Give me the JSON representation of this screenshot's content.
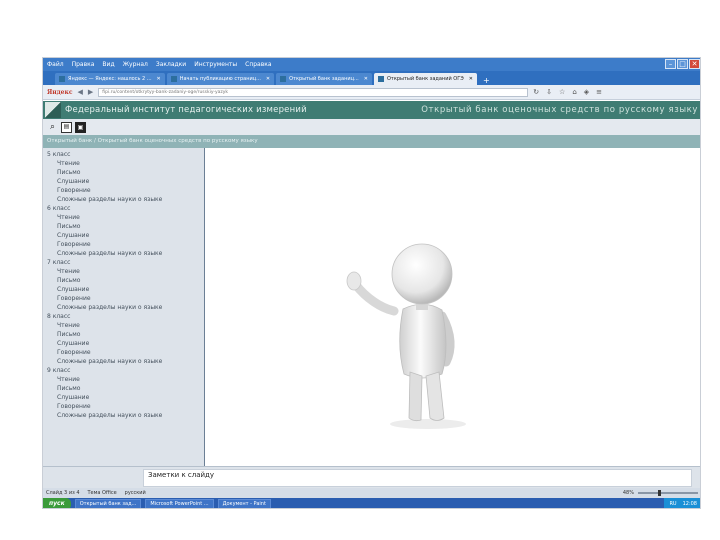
{
  "browser": {
    "menu": [
      "Файл",
      "Правка",
      "Вид",
      "Журнал",
      "Закладки",
      "Инструменты",
      "Справка"
    ],
    "tabs": [
      {
        "label": "Яндекс — Яндекс: нашлось 2 ..."
      },
      {
        "label": "Начать публикацию страниц..."
      },
      {
        "label": "Открытый банк заданиц..."
      },
      {
        "label": "Открытый банк заданий ОГЭ"
      }
    ],
    "active_tab": 3,
    "brand": "Яндекс",
    "url": "fipi.ru/content/otkrytyy-bank-zadaniy-oge/russkiy-yazyk",
    "search_placeholder": "Поиск",
    "colors": {
      "titlebar": "#3d7cc9",
      "header": "#3f7c73",
      "close": "#d34a3a"
    }
  },
  "site": {
    "institute": "Федеральный институт педагогических измерений",
    "bank_title": "Открытый банк оценочных средств по русскому языку",
    "breadcrumb": "Открытый банк / Открытый банк оценочных средств по русскому языку"
  },
  "sidebar": {
    "grades": [
      {
        "label": "5 класс",
        "items": [
          "Чтение",
          "Письмо",
          "Слушание",
          "Говорение",
          "Сложные разделы науки о языке"
        ]
      },
      {
        "label": "6 класс",
        "items": [
          "Чтение",
          "Письмо",
          "Слушание",
          "Говорение",
          "Сложные разделы науки о языке"
        ]
      },
      {
        "label": "7 класс",
        "items": [
          "Чтение",
          "Письмо",
          "Слушание",
          "Говорение",
          "Сложные разделы науки о языке"
        ]
      },
      {
        "label": "8 класс",
        "items": [
          "Чтение",
          "Письмо",
          "Слушание",
          "Говорение",
          "Сложные разделы науки о языке"
        ]
      },
      {
        "label": "9 класс",
        "items": [
          "Чтение",
          "Письмо",
          "Слушание",
          "Говорение",
          "Сложные разделы науки о языке"
        ]
      }
    ]
  },
  "notes": {
    "text": "Заметки к слайду"
  },
  "status": {
    "slide": "Слайд 3 из 4",
    "theme": "Тема Office",
    "lang": "русский",
    "zoom": "48%"
  },
  "taskbar": {
    "start": "пуск",
    "tasks": [
      "Открытый банк зад...",
      "Microsoft PowerPoint ...",
      "Документ - Paint"
    ],
    "tray": [
      "RU",
      "12:08"
    ]
  }
}
